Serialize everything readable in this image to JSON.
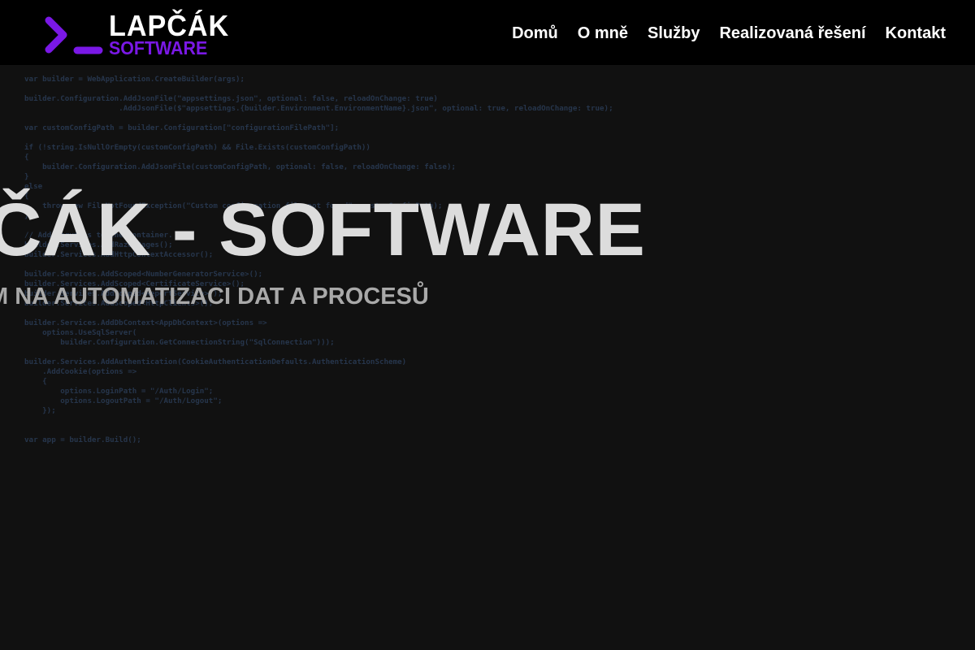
{
  "header": {
    "logo": {
      "word_top": "LAPČÁK",
      "word_bottom": "SOFTWARE",
      "icon": "terminal-prompt-icon",
      "accent": "#7a18e6"
    },
    "nav": [
      "Domů",
      "O mně",
      "Služby",
      "Realizovaná řešení",
      "Kontakt"
    ]
  },
  "hero": {
    "headline": "ČÁK - SOFTWARE",
    "subheadline": "M NA AUTOMATIZACI DAT A PROCESŮ",
    "code_lines": [
      "var builder = WebApplication.CreateBuilder(args);",
      "",
      "builder.Configuration.AddJsonFile(\"appsettings.json\", optional: false, reloadOnChange: true)",
      "                     .AddJsonFile($\"appsettings.{builder.Environment.EnvironmentName}.json\", optional: true, reloadOnChange: true);",
      "",
      "var customConfigPath = builder.Configuration[\"configurationFilePath\"];",
      "",
      "if (!string.IsNullOrEmpty(customConfigPath) && File.Exists(customConfigPath))",
      "{",
      "    builder.Configuration.AddJsonFile(customConfigPath, optional: false, reloadOnChange: false);",
      "}",
      "else",
      "{",
      "    throw new FileNotFoundException(\"Custom configuration file not found\", customConfigPath);",
      "}",
      "",
      "// Add services to the container.",
      "builder.Services.AddRazorPages();",
      "builder.Services.AddHttpContextAccessor();",
      "",
      "builder.Services.AddScoped<NumberGeneratorService>();",
      "builder.Services.AddScoped<CertificateService>();",
      "builder.Services.AddScoped<ReportService>();",
      "builder.Services.AddScoped<HttpClients>();",
      "",
      "builder.Services.AddDbContext<AppDbContext>(options =>",
      "    options.UseSqlServer(",
      "        builder.Configuration.GetConnectionString(\"SqlConnection\")));",
      "",
      "builder.Services.AddAuthentication(CookieAuthenticationDefaults.AuthenticationScheme)",
      "    .AddCookie(options =>",
      "    {",
      "        options.LoginPath = \"/Auth/Login\";",
      "        options.LogoutPath = \"/Auth/Logout\";",
      "    });",
      "",
      "",
      "var app = builder.Build();"
    ]
  }
}
